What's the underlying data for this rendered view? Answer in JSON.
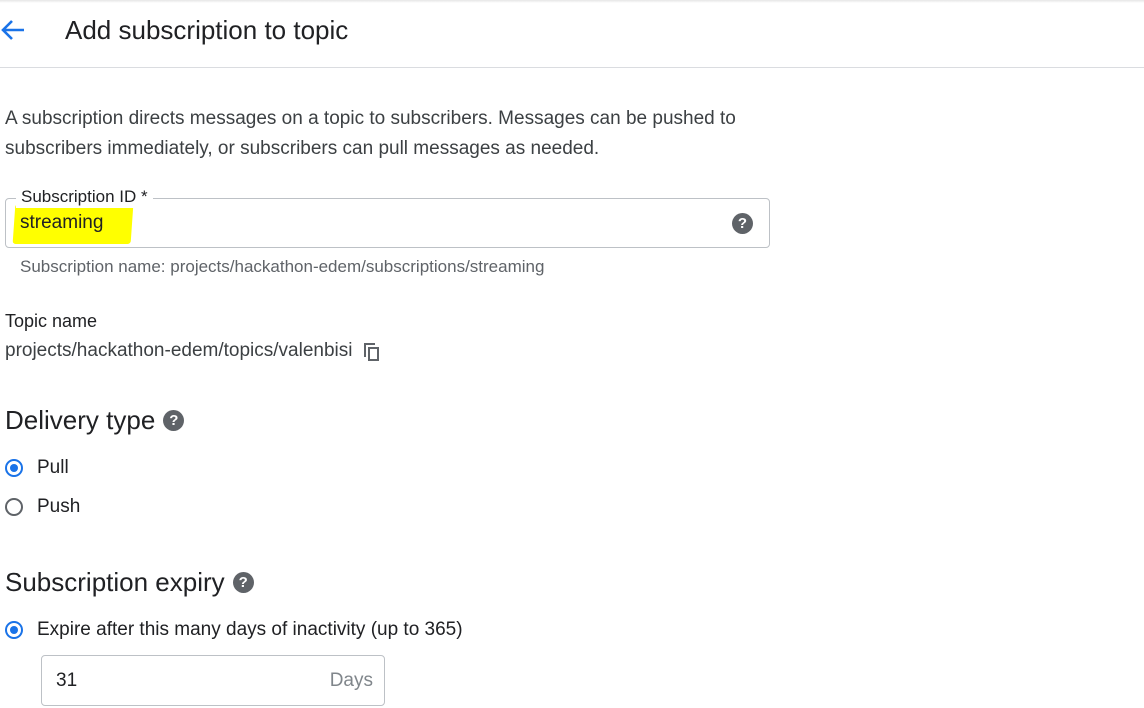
{
  "header": {
    "title": "Add subscription to topic"
  },
  "description": "A subscription directs messages on a topic to subscribers. Messages can be pushed to subscribers immediately, or subscribers can pull messages as needed.",
  "subscription_id": {
    "label": "Subscription ID *",
    "value": "streaming",
    "hint": "Subscription name: projects/hackathon-edem/subscriptions/streaming",
    "help_icon": "help-icon",
    "highlight_color": "#ffff00"
  },
  "topic": {
    "label": "Topic name",
    "value": "projects/hackathon-edem/topics/valenbisi",
    "copy_icon": "copy-icon"
  },
  "delivery_type": {
    "title": "Delivery type",
    "options": [
      {
        "label": "Pull",
        "checked": true
      },
      {
        "label": "Push",
        "checked": false
      }
    ]
  },
  "expiry": {
    "title": "Subscription expiry",
    "option_label": "Expire after this many days of inactivity (up to 365)",
    "option_checked": true,
    "days_value": "31",
    "days_suffix": "Days"
  },
  "colors": {
    "accent": "#1a73e8",
    "text": "#202124",
    "border": "#bdc1c6"
  }
}
